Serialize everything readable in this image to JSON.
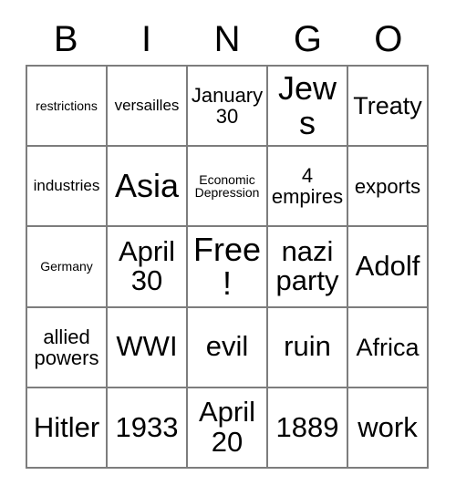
{
  "card": {
    "title_letters": [
      "B",
      "I",
      "N",
      "G",
      "O"
    ],
    "border_color": "#7d7d7d",
    "background_color": "#ffffff",
    "text_color": "#000000",
    "rows": [
      [
        {
          "text": "restrictions",
          "size": "fs-xs"
        },
        {
          "text": "versailles",
          "size": "fs-s"
        },
        {
          "text": "January 30",
          "size": "fs-m"
        },
        {
          "text": "Jews",
          "size": "fs-xxl"
        },
        {
          "text": "Treaty",
          "size": "fs-l"
        }
      ],
      [
        {
          "text": "industries",
          "size": "fs-s"
        },
        {
          "text": "Asia",
          "size": "fs-xxl"
        },
        {
          "text": "Economic Depression",
          "size": "fs-xs"
        },
        {
          "text": "4 empires",
          "size": "fs-m"
        },
        {
          "text": "exports",
          "size": "fs-m"
        }
      ],
      [
        {
          "text": "Germany",
          "size": "fs-xs"
        },
        {
          "text": "April 30",
          "size": "fs-xl"
        },
        {
          "text": "Free!",
          "size": "fs-xxl"
        },
        {
          "text": "nazi party",
          "size": "fs-xl"
        },
        {
          "text": "Adolf",
          "size": "fs-xl"
        }
      ],
      [
        {
          "text": "allied powers",
          "size": "fs-m"
        },
        {
          "text": "WWI",
          "size": "fs-xl"
        },
        {
          "text": "evil",
          "size": "fs-xl"
        },
        {
          "text": "ruin",
          "size": "fs-xl"
        },
        {
          "text": "Africa",
          "size": "fs-l"
        }
      ],
      [
        {
          "text": "Hitler",
          "size": "fs-xl"
        },
        {
          "text": "1933",
          "size": "fs-xl"
        },
        {
          "text": "April 20",
          "size": "fs-xl"
        },
        {
          "text": "1889",
          "size": "fs-xl"
        },
        {
          "text": "work",
          "size": "fs-xl"
        }
      ]
    ]
  }
}
